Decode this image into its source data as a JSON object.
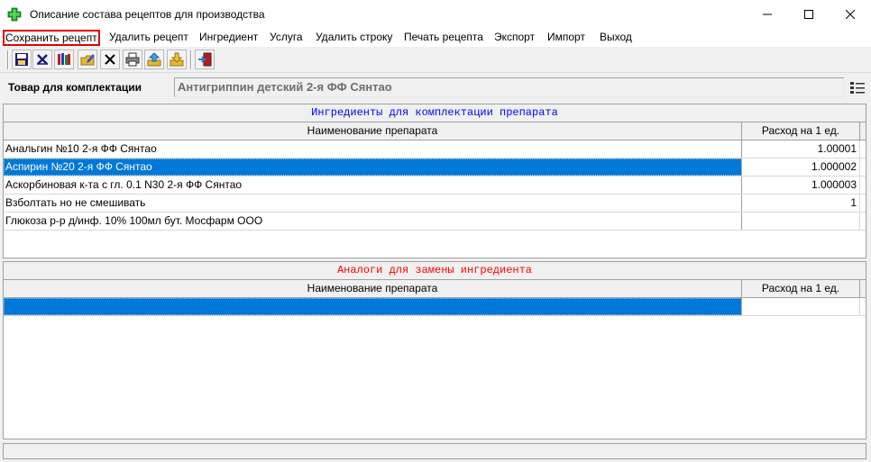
{
  "window": {
    "title": "Описание состава рецептов для производства",
    "icon": "green-cross-icon",
    "accent": "#0078d7"
  },
  "menu": {
    "items": [
      {
        "label": "Сохранить рецепт",
        "highlighted": true
      },
      {
        "label": "Удалить рецепт"
      },
      {
        "label": "Ингредиент"
      },
      {
        "label": "Услуга"
      },
      {
        "label": "Удалить строку"
      },
      {
        "label": "Печать рецепта"
      },
      {
        "label": "Экспорт"
      },
      {
        "label": "Импорт"
      },
      {
        "label": "Выход"
      }
    ]
  },
  "toolbar": {
    "icons": [
      "save-icon",
      "delete-icon",
      "books-icon",
      "edit-folder-icon",
      "close-x-icon",
      "print-icon",
      "export-icon",
      "import-icon",
      "exit-door-icon"
    ]
  },
  "product": {
    "label": "Товар для комплектации",
    "value": "Антигриппин детский 2-я ФФ Сянтао"
  },
  "ingredients": {
    "title": "Ингредиенты для комплектации препарата",
    "title_color": "#0000ff",
    "columns": [
      "Наименование препарата",
      "Расход на 1 ед."
    ],
    "rows": [
      {
        "name": "Анальгин №10 2-я ФФ Сянтао",
        "qty": "1.00001"
      },
      {
        "name": "Аспирин №20 2-я ФФ Сянтао",
        "qty": "1.000002",
        "selected": true
      },
      {
        "name": "Аскорбиновая к-та с гл. 0.1 N30 2-я ФФ Сянтао",
        "qty": "1.000003"
      },
      {
        "name": "Взболтать но не смешивать",
        "qty": "1"
      },
      {
        "name": "Глюкоза р-р д/инф. 10% 100мл бут. Мосфарм ООО",
        "qty": ""
      }
    ]
  },
  "analogs": {
    "title": "Аналоги для замены ингредиента",
    "title_color": "#ff0000",
    "columns": [
      "Наименование препарата",
      "Расход на 1 ед."
    ],
    "rows": [
      {
        "name": "",
        "qty": "",
        "selected": true
      }
    ]
  }
}
